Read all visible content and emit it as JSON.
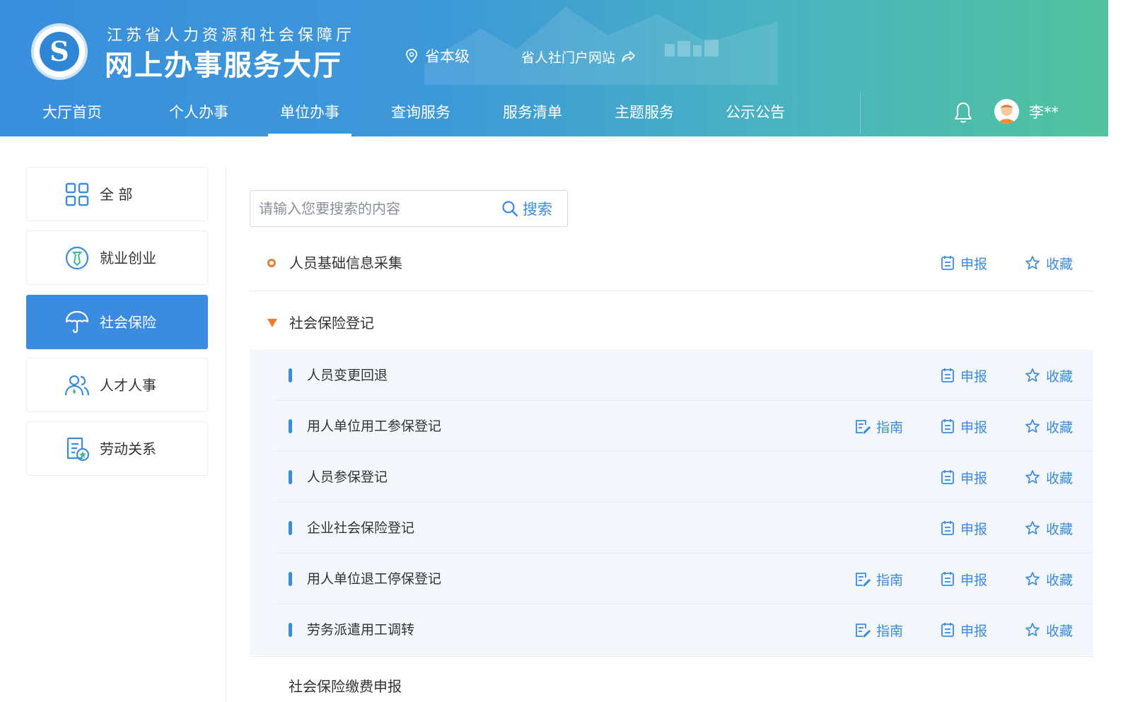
{
  "header": {
    "org_name": "江苏省人力资源和社会保障厅",
    "hall_name": "网上办事服务大厅",
    "level": "省本级",
    "portal_link": "省人社门户网站",
    "colors": {
      "gradient_start": "#3a8fdc",
      "gradient_end": "#52c39e"
    }
  },
  "nav": {
    "items": [
      {
        "label": "大厅首页"
      },
      {
        "label": "个人办事"
      },
      {
        "label": "单位办事"
      },
      {
        "label": "查询服务"
      },
      {
        "label": "服务清单"
      },
      {
        "label": "主题服务"
      },
      {
        "label": "公示公告"
      }
    ],
    "active_index": 2
  },
  "user": {
    "name": "李**"
  },
  "sidebar": {
    "items": [
      {
        "label": "全 部",
        "icon": "grid-icon"
      },
      {
        "label": "就业创业",
        "icon": "employment-icon"
      },
      {
        "label": "社会保险",
        "icon": "umbrella-icon"
      },
      {
        "label": "人才人事",
        "icon": "people-icon"
      },
      {
        "label": "劳动关系",
        "icon": "contract-icon"
      }
    ],
    "active_index": 2,
    "active_color": "#3b8be0"
  },
  "search": {
    "placeholder": "请输入您要搜索的内容",
    "button_label": "搜索"
  },
  "actions": {
    "guide": "指南",
    "apply": "申报",
    "favorite": "收藏"
  },
  "list": {
    "top_item": {
      "name": "人员基础信息采集"
    },
    "group": {
      "name": "社会保险登记",
      "items": [
        {
          "name": "人员变更回退",
          "has_guide": false
        },
        {
          "name": "用人单位用工参保登记",
          "has_guide": true
        },
        {
          "name": "人员参保登记",
          "has_guide": false
        },
        {
          "name": "企业社会保险登记",
          "has_guide": false
        },
        {
          "name": "用人单位退工停保登记",
          "has_guide": true
        },
        {
          "name": "劳务派遣用工调转",
          "has_guide": true
        }
      ]
    },
    "next_group_partial": "社会保险缴费申报"
  }
}
